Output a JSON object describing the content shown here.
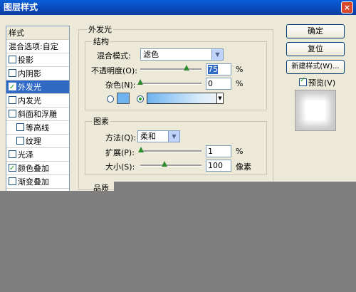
{
  "window": {
    "title": "图层样式",
    "close_glyph": "×"
  },
  "left_list": {
    "header": "样式",
    "items": [
      {
        "label": "混合选项:自定",
        "check": null,
        "selected": false,
        "indent": false
      },
      {
        "label": "投影",
        "check": false,
        "selected": false,
        "indent": false
      },
      {
        "label": "内阴影",
        "check": false,
        "selected": false,
        "indent": false
      },
      {
        "label": "外发光",
        "check": true,
        "selected": true,
        "indent": false
      },
      {
        "label": "内发光",
        "check": false,
        "selected": false,
        "indent": false
      },
      {
        "label": "斜面和浮雕",
        "check": false,
        "selected": false,
        "indent": false
      },
      {
        "label": "等高线",
        "check": false,
        "selected": false,
        "indent": true
      },
      {
        "label": "纹理",
        "check": false,
        "selected": false,
        "indent": true
      },
      {
        "label": "光泽",
        "check": false,
        "selected": false,
        "indent": false
      },
      {
        "label": "颜色叠加",
        "check": true,
        "selected": false,
        "indent": false
      },
      {
        "label": "渐变叠加",
        "check": false,
        "selected": false,
        "indent": false
      }
    ]
  },
  "outer_glow": {
    "title": "外发光",
    "structure": {
      "title": "结构",
      "blend_mode_label": "混合模式:",
      "blend_mode_value": "滤色",
      "opacity_label": "不透明度(O):",
      "opacity_value": "75",
      "opacity_unit": "%",
      "opacity_level": 0.75,
      "noise_label": "杂色(N):",
      "noise_value": "0",
      "noise_unit": "%",
      "noise_level": 0
    },
    "elements": {
      "title": "图素",
      "method_label": "方法(Q):",
      "method_value": "柔和",
      "spread_label": "扩展(P):",
      "spread_value": "1",
      "spread_unit": "%",
      "spread_level": 0.01,
      "size_label": "大小(S):",
      "size_value": "100",
      "size_unit": "像素",
      "size_level": 0.4
    },
    "quality": {
      "title": "品质"
    }
  },
  "buttons": {
    "ok": "确定",
    "reset": "复位",
    "new_style": "新建样式(W)...",
    "preview_label": "预览(V)"
  },
  "colors": {
    "glow_color": "#6fb4f0",
    "accent": "#316ac5"
  }
}
